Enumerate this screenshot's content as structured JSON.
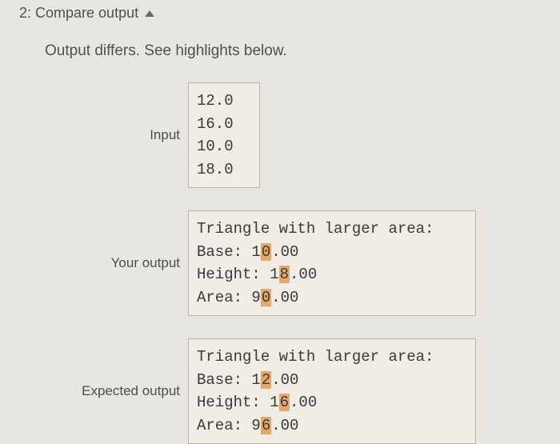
{
  "section": {
    "title": "2: Compare output",
    "message": "Output differs. See highlights below."
  },
  "labels": {
    "input": "Input",
    "your_output": "Your output",
    "expected_output": "Expected output"
  },
  "input": {
    "lines": [
      "12.0",
      "16.0",
      "10.0",
      "18.0"
    ]
  },
  "your_output": {
    "preamble": "Triangle with larger area:",
    "base_label": "Base: 1",
    "base_diff": "0",
    "base_rest": ".00",
    "height_label": "Height: 1",
    "height_diff": "8",
    "height_rest": ".00",
    "area_label": "Area: 9",
    "area_diff": "0",
    "area_rest": ".00"
  },
  "expected_output": {
    "preamble": "Triangle with larger area:",
    "base_label": "Base: 1",
    "base_diff": "2",
    "base_rest": ".00",
    "height_label": "Height: 1",
    "height_diff": "6",
    "height_rest": ".00",
    "area_label": "Area: 9",
    "area_diff": "6",
    "area_rest": ".00"
  }
}
